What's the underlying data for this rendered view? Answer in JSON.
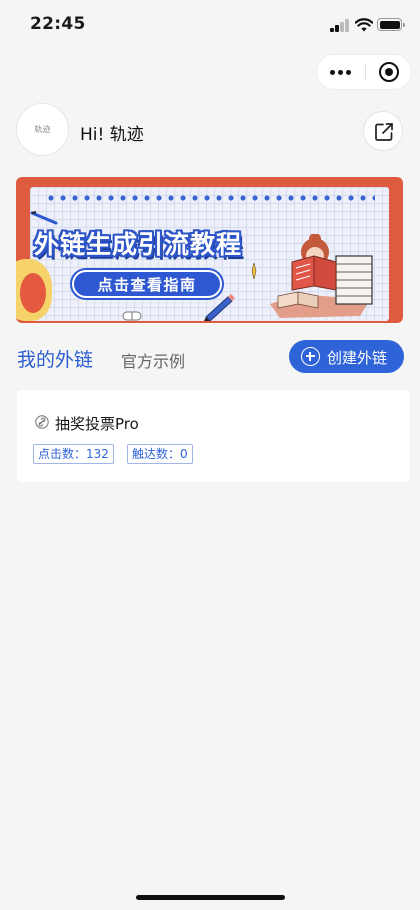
{
  "status_bar": {
    "time": "22:45",
    "icons": [
      "signal-icon",
      "wifi-icon",
      "battery-icon"
    ]
  },
  "capsule": {
    "icons": [
      "more-icon",
      "close-miniprogram-icon"
    ]
  },
  "header": {
    "avatar_text": "轨迹",
    "greeting": "Hi! 轨迹",
    "share_icon": "share-icon"
  },
  "banner": {
    "title": "外链生成引流教程",
    "cta": "点击查看指南",
    "colors": {
      "border": "#df5b40",
      "accent": "#2d58d2",
      "background": "#edf0fa"
    }
  },
  "tabs": [
    {
      "label": "我的外链",
      "active": true
    },
    {
      "label": "官方示例",
      "active": false
    }
  ],
  "create_button": {
    "label": "创建外链",
    "icon": "plus-circle-icon"
  },
  "links": [
    {
      "icon": "link-icon",
      "title": "抽奖投票Pro",
      "stats": {
        "clicks": "点击数：132",
        "reach": "触达数：0"
      }
    }
  ],
  "colors": {
    "primary": "#2f64d9",
    "page_background": "#f5f5f5"
  }
}
